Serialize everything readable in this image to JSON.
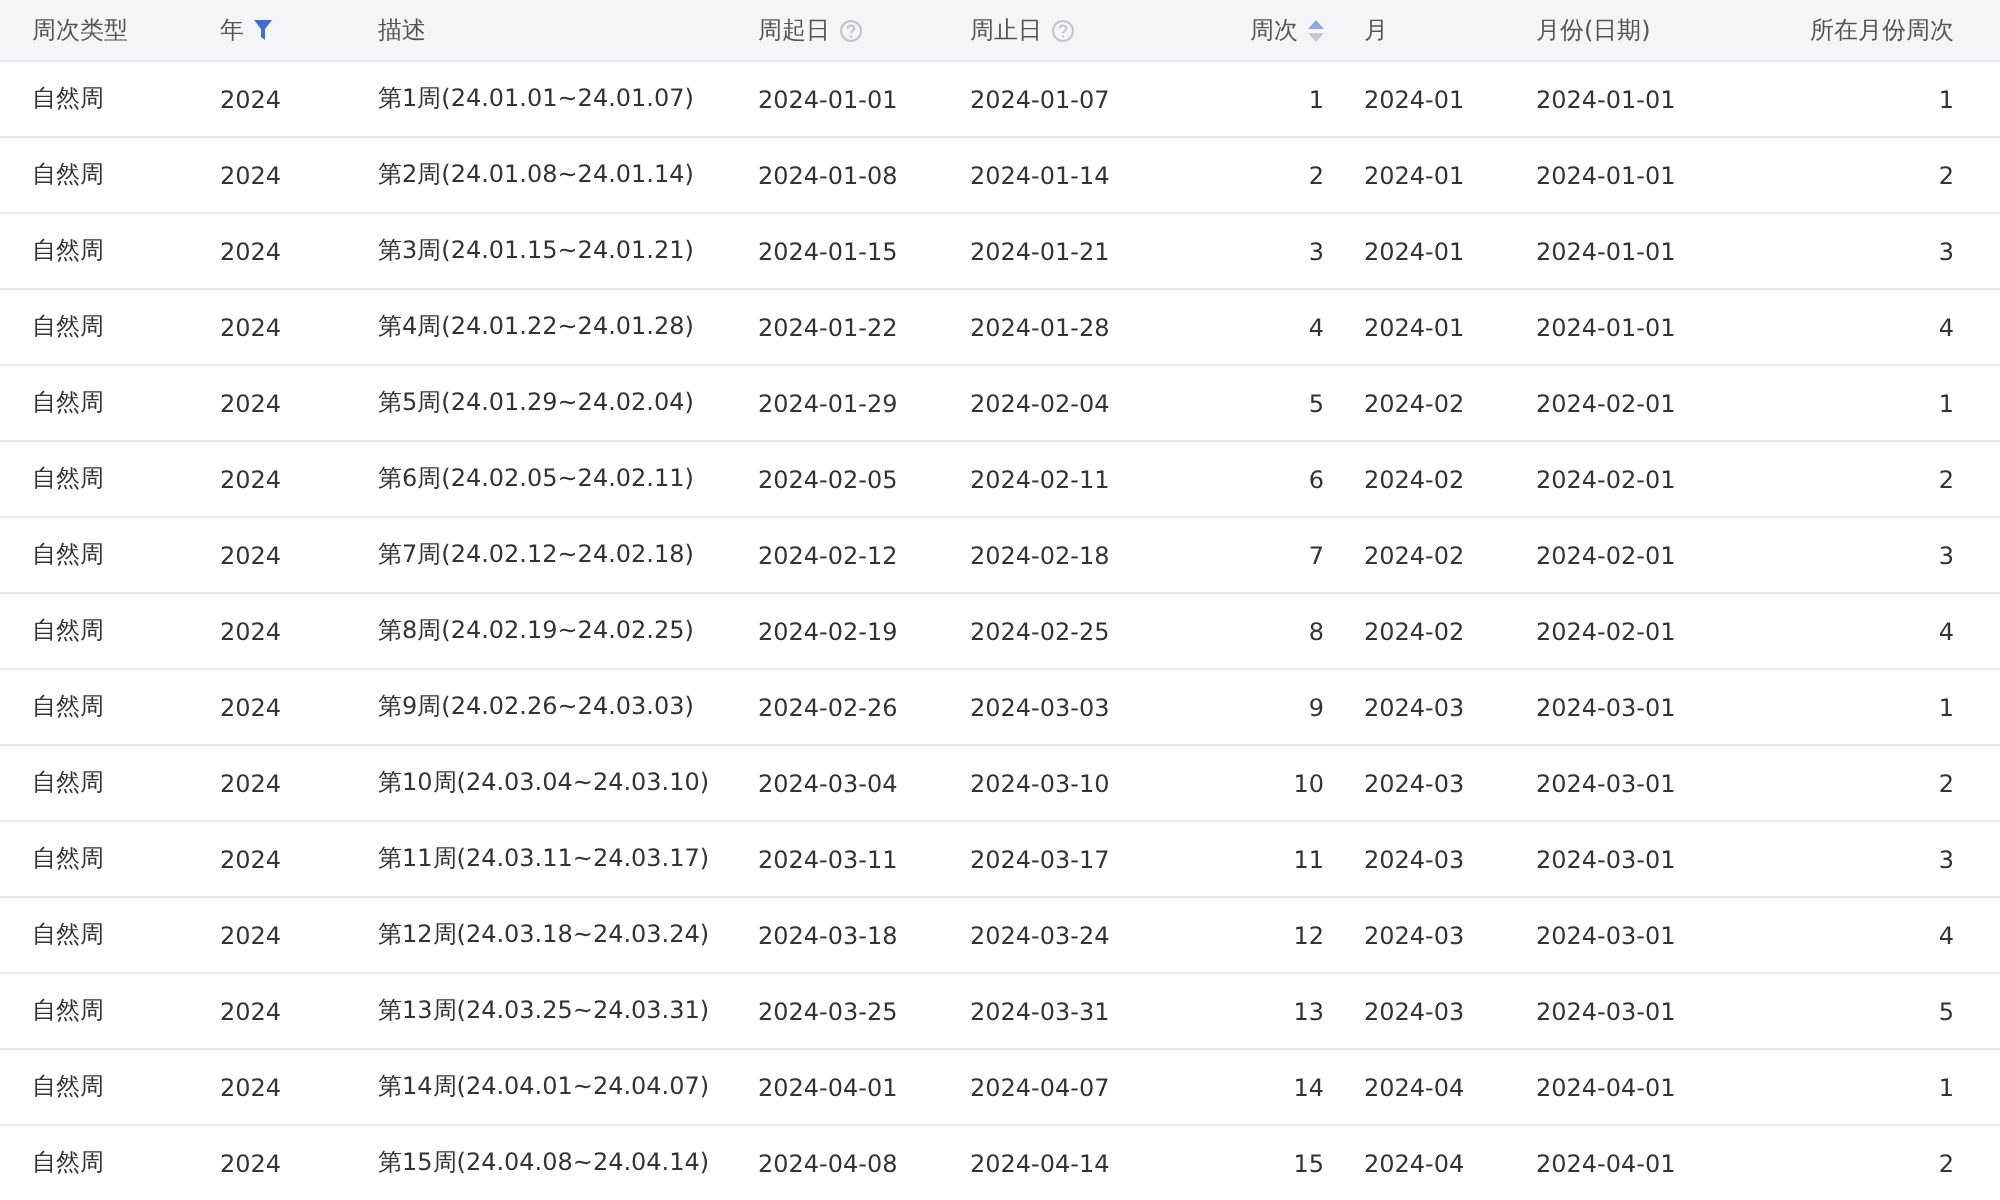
{
  "table": {
    "columns": [
      {
        "label": "周次类型",
        "kind": "plain"
      },
      {
        "label": "年",
        "kind": "filter"
      },
      {
        "label": "描述",
        "kind": "plain"
      },
      {
        "label": "周起日",
        "kind": "help"
      },
      {
        "label": "周止日",
        "kind": "help"
      },
      {
        "label": "周次",
        "kind": "sort"
      },
      {
        "label": "月",
        "kind": "plain"
      },
      {
        "label": "月份(日期)",
        "kind": "plain"
      },
      {
        "label": "所在月份周次",
        "kind": "plain"
      }
    ],
    "rows": [
      [
        "自然周",
        "2024",
        "第1周(24.01.01~24.01.07)",
        "2024-01-01",
        "2024-01-07",
        "1",
        "2024-01",
        "2024-01-01",
        "1"
      ],
      [
        "自然周",
        "2024",
        "第2周(24.01.08~24.01.14)",
        "2024-01-08",
        "2024-01-14",
        "2",
        "2024-01",
        "2024-01-01",
        "2"
      ],
      [
        "自然周",
        "2024",
        "第3周(24.01.15~24.01.21)",
        "2024-01-15",
        "2024-01-21",
        "3",
        "2024-01",
        "2024-01-01",
        "3"
      ],
      [
        "自然周",
        "2024",
        "第4周(24.01.22~24.01.28)",
        "2024-01-22",
        "2024-01-28",
        "4",
        "2024-01",
        "2024-01-01",
        "4"
      ],
      [
        "自然周",
        "2024",
        "第5周(24.01.29~24.02.04)",
        "2024-01-29",
        "2024-02-04",
        "5",
        "2024-02",
        "2024-02-01",
        "1"
      ],
      [
        "自然周",
        "2024",
        "第6周(24.02.05~24.02.11)",
        "2024-02-05",
        "2024-02-11",
        "6",
        "2024-02",
        "2024-02-01",
        "2"
      ],
      [
        "自然周",
        "2024",
        "第7周(24.02.12~24.02.18)",
        "2024-02-12",
        "2024-02-18",
        "7",
        "2024-02",
        "2024-02-01",
        "3"
      ],
      [
        "自然周",
        "2024",
        "第8周(24.02.19~24.02.25)",
        "2024-02-19",
        "2024-02-25",
        "8",
        "2024-02",
        "2024-02-01",
        "4"
      ],
      [
        "自然周",
        "2024",
        "第9周(24.02.26~24.03.03)",
        "2024-02-26",
        "2024-03-03",
        "9",
        "2024-03",
        "2024-03-01",
        "1"
      ],
      [
        "自然周",
        "2024",
        "第10周(24.03.04~24.03.10)",
        "2024-03-04",
        "2024-03-10",
        "10",
        "2024-03",
        "2024-03-01",
        "2"
      ],
      [
        "自然周",
        "2024",
        "第11周(24.03.11~24.03.17)",
        "2024-03-11",
        "2024-03-17",
        "11",
        "2024-03",
        "2024-03-01",
        "3"
      ],
      [
        "自然周",
        "2024",
        "第12周(24.03.18~24.03.24)",
        "2024-03-18",
        "2024-03-24",
        "12",
        "2024-03",
        "2024-03-01",
        "4"
      ],
      [
        "自然周",
        "2024",
        "第13周(24.03.25~24.03.31)",
        "2024-03-25",
        "2024-03-31",
        "13",
        "2024-03",
        "2024-03-01",
        "5"
      ],
      [
        "自然周",
        "2024",
        "第14周(24.04.01~24.04.07)",
        "2024-04-01",
        "2024-04-07",
        "14",
        "2024-04",
        "2024-04-01",
        "1"
      ],
      [
        "自然周",
        "2024",
        "第15周(24.04.08~24.04.14)",
        "2024-04-08",
        "2024-04-14",
        "15",
        "2024-04",
        "2024-04-01",
        "2"
      ]
    ]
  }
}
